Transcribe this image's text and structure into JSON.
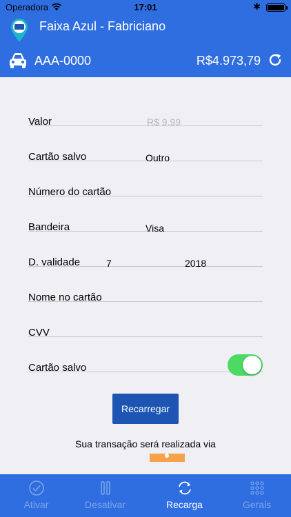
{
  "status_bar": {
    "carrier": "Operadora",
    "time": "17:01",
    "bluetooth": "✱"
  },
  "app": {
    "title": "Faixa Azul - Fabriciano",
    "logo_text": "FAIXA AZUL"
  },
  "vehicle": {
    "plate": "AAA-0000",
    "balance": "R$4.973,79"
  },
  "form": {
    "valor": {
      "label": "Valor",
      "placeholder": "R$ 9.99"
    },
    "cartao_salvo_select": {
      "label": "Cartão salvo",
      "value": "Outro"
    },
    "numero": {
      "label": "Número do cartão"
    },
    "bandeira": {
      "label": "Bandeira",
      "value": "Visa"
    },
    "validade": {
      "label": "D. validade",
      "month": "7",
      "year": "2018"
    },
    "nome": {
      "label": "Nome no cartão"
    },
    "cvv": {
      "label": "CVV"
    },
    "salvar": {
      "label": "Cartão salvo",
      "on": true
    }
  },
  "actions": {
    "recharge_button": "Recarregar",
    "via_text": "Sua transação será realizada via"
  },
  "tabs": [
    {
      "label": "Ativar",
      "icon": "check-circle-icon"
    },
    {
      "label": "Desativar",
      "icon": "pause-icon"
    },
    {
      "label": "Recarga",
      "icon": "refresh-icon",
      "active": true
    },
    {
      "label": "Gerais",
      "icon": "grid-icon"
    }
  ],
  "colors": {
    "primary": "#2f6ee0",
    "button": "#1e55b3",
    "toggle_on": "#4cd964",
    "inactive_tab": "#7ea4ea"
  }
}
